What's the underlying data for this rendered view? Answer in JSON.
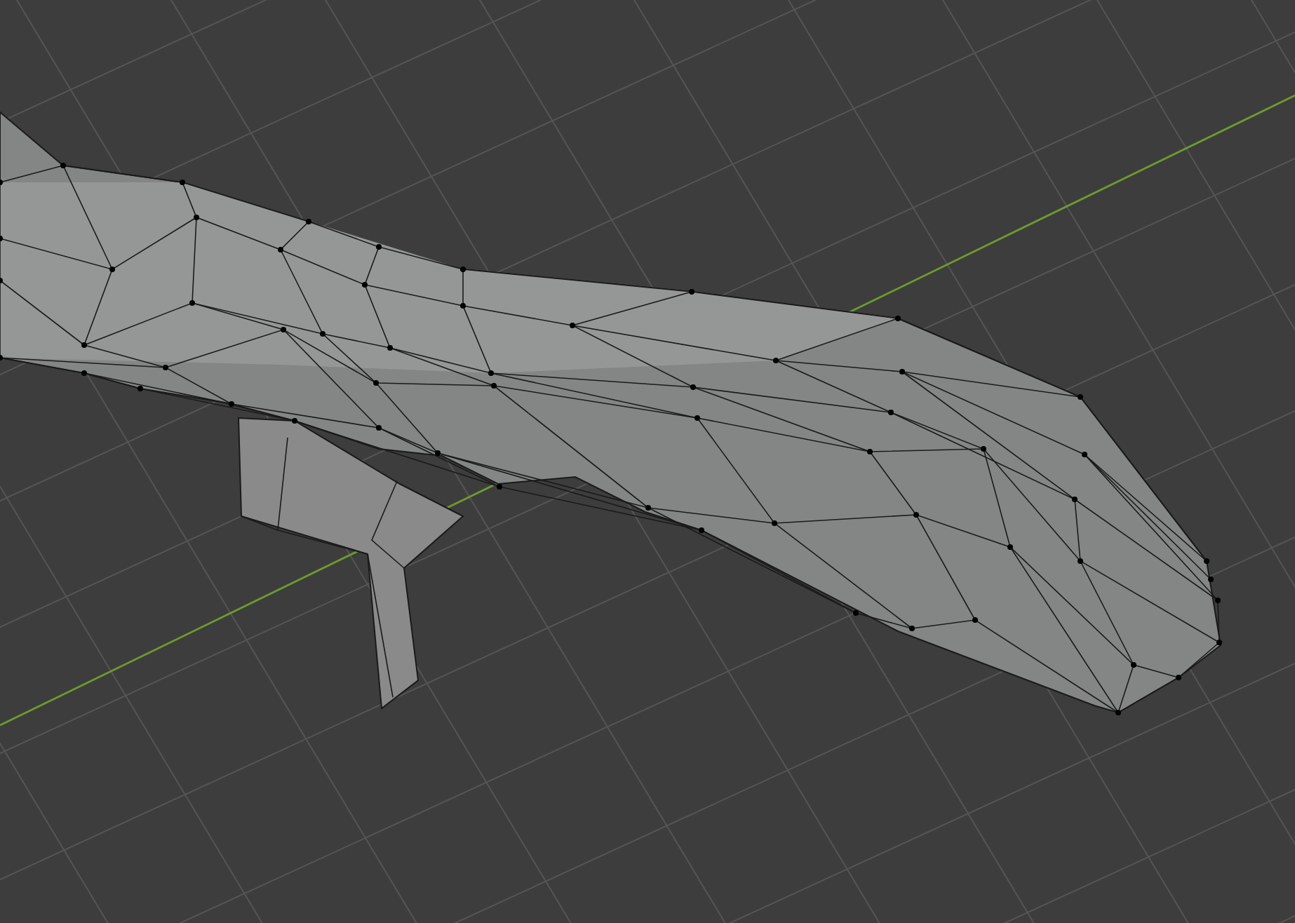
{
  "viewport": {
    "grid": true,
    "axis_line": true,
    "show_vertices": true
  }
}
